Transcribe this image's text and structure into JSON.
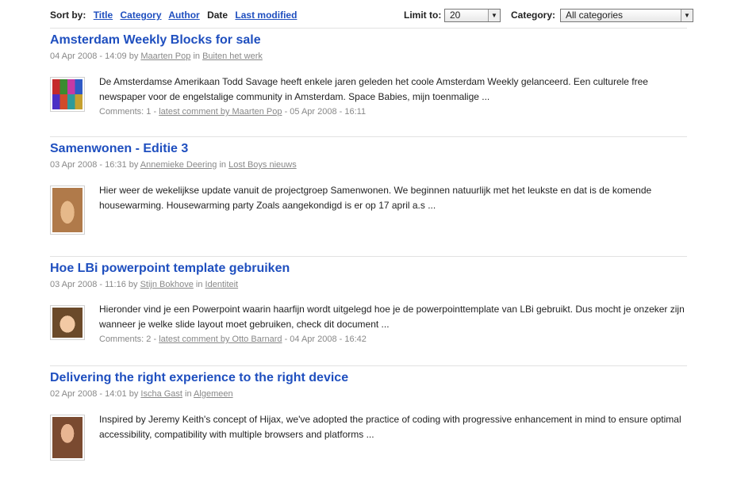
{
  "toolbar": {
    "sort_label": "Sort by:",
    "sort_options": [
      "Title",
      "Category",
      "Author",
      "Date",
      "Last modified"
    ],
    "active_sort": "Date",
    "limit_label": "Limit to:",
    "limit_value": "20",
    "category_label": "Category:",
    "category_value": "All categories"
  },
  "posts": [
    {
      "title": "Amsterdam Weekly Blocks for sale",
      "date": "04 Apr 2008 - 14:09",
      "by": "by",
      "author": "Maarten Pop",
      "in": "in",
      "category": "Buiten het werk",
      "excerpt": "De Amsterdamse Amerikaan Todd Savage heeft enkele jaren geleden het coole Amsterdam Weekly gelanceerd. Een culturele free newspaper voor de engelstalige community in Amsterdam. Space Babies, mijn toenmalige ...",
      "comments_prefix": "Comments: 1 -",
      "comments_link": "latest comment by Maarten Pop",
      "comments_suffix": "- 05 Apr 2008 - 16:11"
    },
    {
      "title": "Samenwonen - Editie 3",
      "date": "03 Apr 2008 - 16:31",
      "by": "by",
      "author": "Annemieke Deering",
      "in": "in",
      "category": "Lost Boys nieuws",
      "excerpt": "Hier weer de wekelijkse update vanuit de projectgroep Samenwonen. We beginnen natuurlijk met het leukste en dat is de komende housewarming. Housewarming party Zoals aangekondigd is er op 17 april a.s ..."
    },
    {
      "title": "Hoe LBi powerpoint template gebruiken",
      "date": "03 Apr 2008 - 11:16",
      "by": "by",
      "author": "Stijn Bokhove",
      "in": "in",
      "category": "Identiteit",
      "excerpt": "Hieronder vind je een Powerpoint waarin haarfijn wordt uitgelegd hoe je de powerpointtemplate van LBi gebruikt. Dus mocht je onzeker zijn wanneer je welke slide layout moet gebruiken, check dit document ...",
      "comments_prefix": "Comments: 2 -",
      "comments_link": "latest comment by Otto Barnard",
      "comments_suffix": "- 04 Apr 2008 - 16:42"
    },
    {
      "title": "Delivering the right experience to the right device",
      "date": "02 Apr 2008 - 14:01",
      "by": "by",
      "author": "Ischa Gast",
      "in": "in",
      "category": "Algemeen",
      "excerpt": "Inspired by Jeremy Keith's concept of Hijax, we've adopted the practice of coding with progressive enhancement in mind to ensure optimal accessibility, compatibility with multiple browsers and platforms ..."
    }
  ]
}
